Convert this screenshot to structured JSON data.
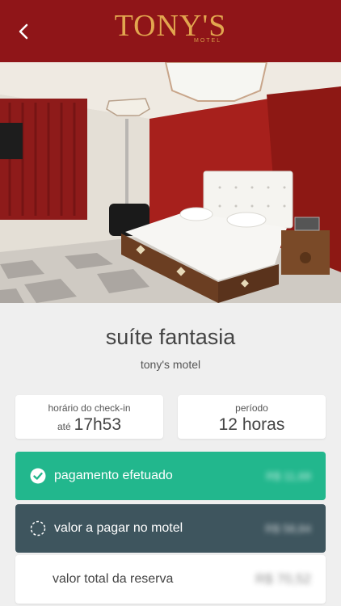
{
  "header": {
    "brand_name": "TONY'S",
    "brand_sub": "MOTEL",
    "back_icon": "chevron-left-icon",
    "color": "#8f1518",
    "brand_color": "#e2a64f"
  },
  "room": {
    "title": "suíte fantasia",
    "motel": "tony's motel"
  },
  "checkin": {
    "label": "horário do check-in",
    "prefix": "até",
    "time": "17h53"
  },
  "period": {
    "label": "período",
    "value": "12 horas"
  },
  "payments": {
    "paid": {
      "label": "pagamento efetuado",
      "amount": "R$ 11,68",
      "icon": "check-circle-icon",
      "color": "#22b78d"
    },
    "due": {
      "label": "valor a pagar no motel",
      "amount": "R$ 58,84",
      "icon": "dashed-circle-icon",
      "color": "#3e555e"
    },
    "total": {
      "label": "valor total da reserva",
      "amount": "R$ 70,52"
    }
  }
}
